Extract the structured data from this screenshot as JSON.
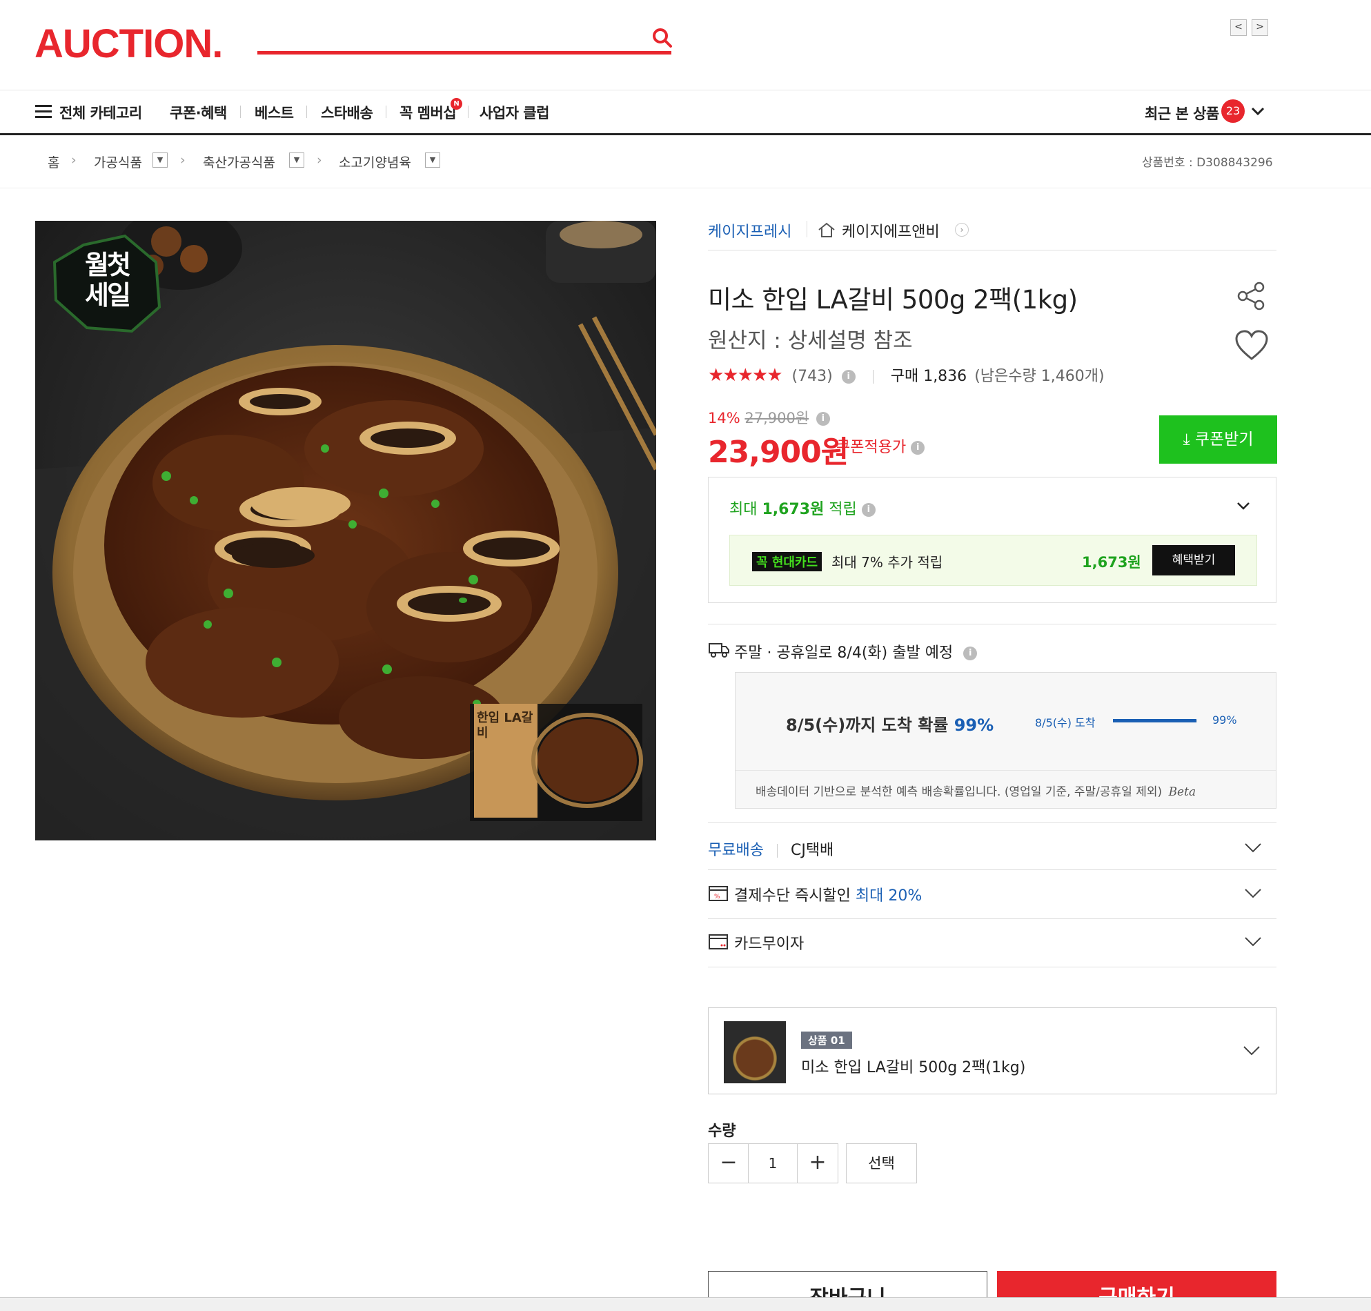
{
  "header": {
    "logo": "AUCTION.",
    "prev": "<",
    "next": ">"
  },
  "nav": {
    "all_categories": "전체 카테고리",
    "items": [
      "쿠폰·혜택",
      "베스트",
      "스타배송",
      "꼭 멤버십",
      "사업자 클럽"
    ],
    "new_badge": "N",
    "recent_label": "최근 본 상품",
    "recent_count": "23"
  },
  "breadcrumb": {
    "home": "홈",
    "items": [
      "가공식품",
      "축산가공식품",
      "소고기양념육"
    ],
    "product_no": "상품번호 : D308843296"
  },
  "product": {
    "badge_top": "월첫",
    "badge_bottom": "세일",
    "pack_label": "한입 LA갈비",
    "seller": "케이지프레시",
    "store": "케이지에프앤비",
    "title": "미소 한입 LA갈비 500g 2팩(1kg)",
    "origin": "원산지 : 상세설명 참조",
    "stars": "★★★★★",
    "rating": 4.5,
    "review_count": "(743)",
    "purchases": "구매 1,836",
    "remaining": "(남은수량 1,460개)",
    "discount": "14%",
    "original_price": "27,900원",
    "price": "23,900원",
    "price_note": "쿠폰적용가",
    "coupon_button": "⤓ 쿠폰받기"
  },
  "points": {
    "prefix": "최대 ",
    "amount": "1,673원",
    "suffix": " 적립",
    "card_logo": "꼭 현대카드",
    "card_text": "최대 7% 추가 적립",
    "card_amount": "1,673원",
    "benefit_button": "혜택받기"
  },
  "shipping": {
    "title": "주말 · 공휴일로 8/4(화) 출발 예정",
    "prob_text": "8/5(수)까지 도착 확률 ",
    "prob_pct": "99%",
    "bar_label": "8/5(수) 도착",
    "bar_pct_label": "99%",
    "bar_value": 0.99,
    "note": "배송데이터 기반으로 분석한 예측 배송확률입니다. (영업일 기준, 주말/공휴일 제외)",
    "beta": "Beta"
  },
  "rows": {
    "free_shipping": "무료배송",
    "courier": "CJ택배",
    "payment": "결제수단 즉시할인 ",
    "payment_max": "최대 20%",
    "interest_free": "카드무이자"
  },
  "option": {
    "tag": "상품 01",
    "name": "미소 한입 LA갈비 500g 2팩(1kg)"
  },
  "quantity": {
    "label": "수량",
    "minus": "−",
    "value": "1",
    "plus": "+",
    "select": "선택"
  },
  "actions": {
    "cart": "장바구니",
    "buy": "구매하기"
  },
  "colors": {
    "brand_red": "#e8262d",
    "accent_green": "#1ec11e",
    "link_blue": "#1a5fb4"
  }
}
